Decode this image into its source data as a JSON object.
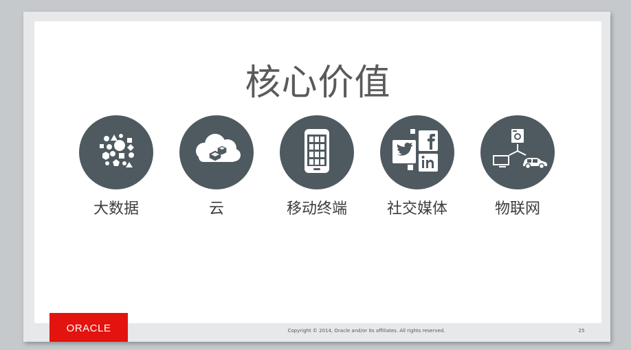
{
  "slide": {
    "title": "核心价值",
    "values": [
      {
        "label": "大数据",
        "icon": "big-data-shapes-icon"
      },
      {
        "label": "云",
        "icon": "cloud-icon"
      },
      {
        "label": "移动终端",
        "icon": "smartphone-icon"
      },
      {
        "label": "社交媒体",
        "icon": "social-media-icon"
      },
      {
        "label": "物联网",
        "icon": "iot-network-icon"
      }
    ],
    "icon_circle_color": "#4e5a60"
  },
  "footer": {
    "logo_text": "ORACLE",
    "logo_color": "#e3130f",
    "copyright": "Copyright © 2014, Oracle and/or its affiliates. All rights reserved.",
    "page_number": "25"
  }
}
